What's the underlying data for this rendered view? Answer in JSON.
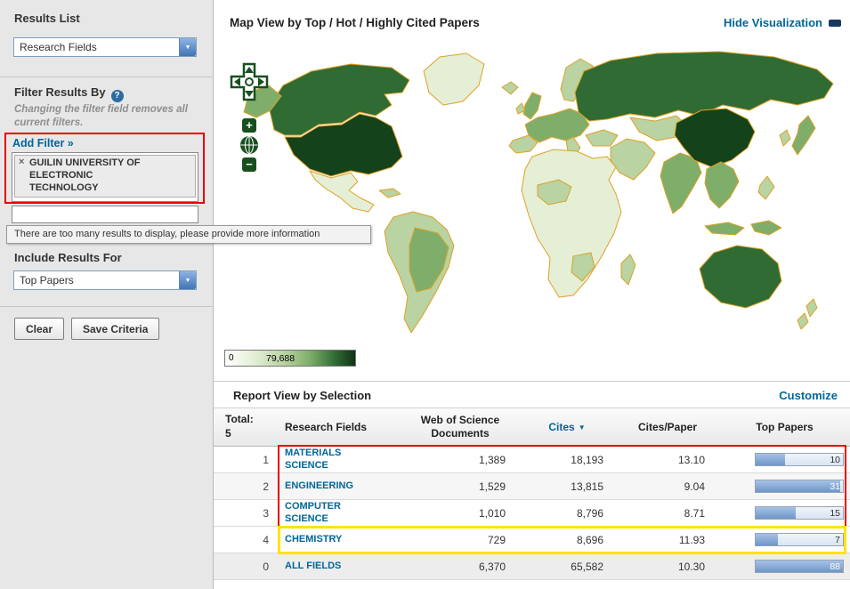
{
  "colors": {
    "accent_blue": "#006699",
    "annotation_red": "#e60000",
    "annotation_yellow": "#ffe400",
    "map_dark_green": "#14421a",
    "bar_fill_blue": "#6f96c8"
  },
  "icons": {
    "chevron_down": "▼",
    "help": "?",
    "remove": "×",
    "zoom_in": "+",
    "zoom_out": "−",
    "sort_desc": "▼"
  },
  "sidebar": {
    "results_list_title": "Results List",
    "results_list_value": "Research Fields",
    "filter_title": "Filter Results By",
    "filter_note": "Changing the filter field removes all current filters.",
    "add_filter": "Add Filter »",
    "filter_chip": "GUILIN UNIVERSITY OF ELECTRONIC TECHNOLOGY",
    "tooltip": "There are too many results to display, please provide more information",
    "include_title": "Include Results For",
    "include_value": "Top Papers",
    "clear_button": "Clear",
    "save_button": "Save Criteria"
  },
  "map": {
    "title": "Map View by Top / Hot / Highly Cited Papers",
    "hide_link": "Hide Visualization",
    "legend_min": "0",
    "legend_max": "79,688"
  },
  "report": {
    "title": "Report View by Selection",
    "customize_link": "Customize",
    "total_label": "Total:",
    "total_value": "5",
    "columns": {
      "field": "Research Fields",
      "docs": "Web of Science Documents",
      "cites": "Cites",
      "cites_per_paper": "Cites/Paper",
      "top_papers": "Top Papers"
    },
    "rows": [
      {
        "rank": "1",
        "field": "MATERIALS SCIENCE",
        "docs": "1,389",
        "cites": "18,193",
        "cites_per_paper": "13.10",
        "top_papers": "10",
        "bar_pct": 34
      },
      {
        "rank": "2",
        "field": "ENGINEERING",
        "docs": "1,529",
        "cites": "13,815",
        "cites_per_paper": "9.04",
        "top_papers": "31",
        "bar_pct": 97
      },
      {
        "rank": "3",
        "field": "COMPUTER SCIENCE",
        "docs": "1,010",
        "cites": "8,796",
        "cites_per_paper": "8.71",
        "top_papers": "15",
        "bar_pct": 46
      },
      {
        "rank": "4",
        "field": "CHEMISTRY",
        "docs": "729",
        "cites": "8,696",
        "cites_per_paper": "11.93",
        "top_papers": "7",
        "bar_pct": 26
      },
      {
        "rank": "0",
        "field": "ALL FIELDS",
        "docs": "6,370",
        "cites": "65,582",
        "cites_per_paper": "10.30",
        "top_papers": "88",
        "bar_pct": 100
      }
    ]
  }
}
